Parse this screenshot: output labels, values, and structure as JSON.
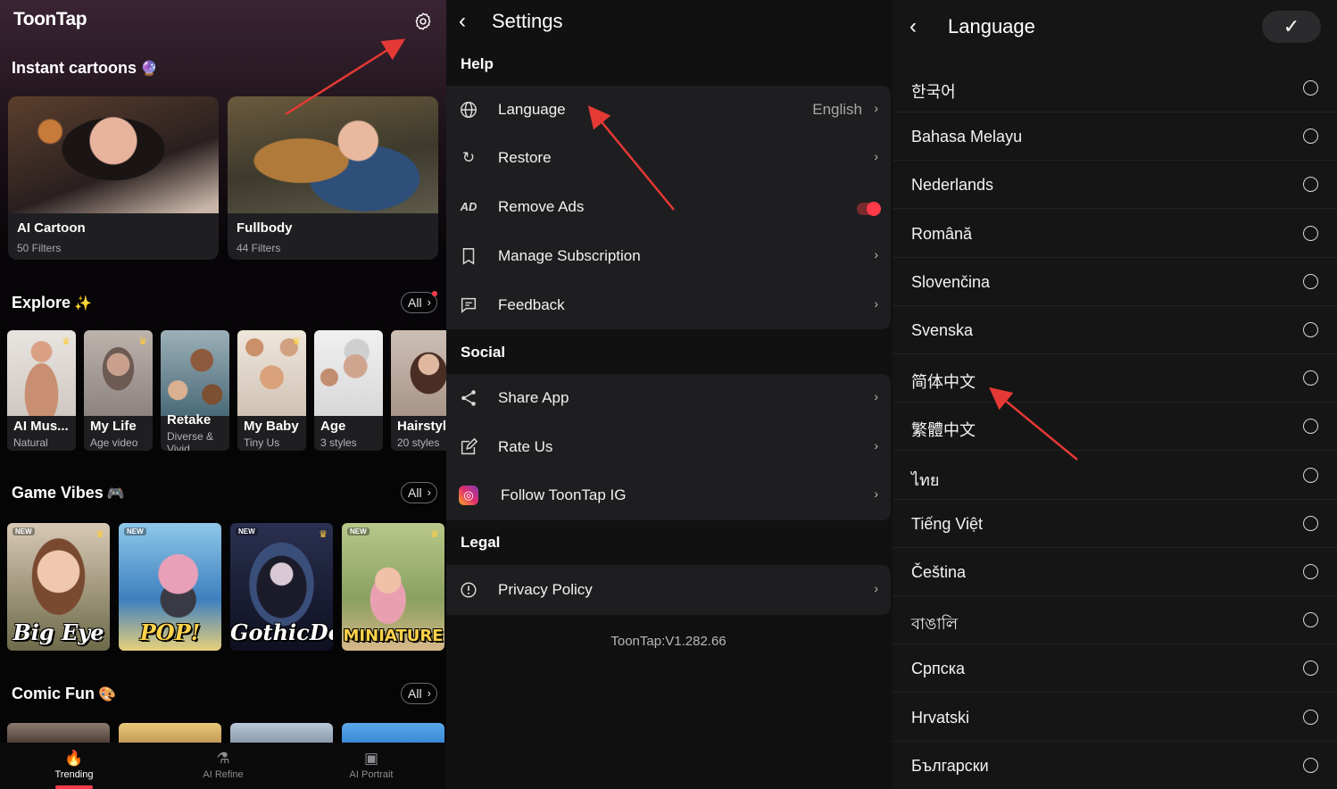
{
  "home": {
    "logo": "ToonTap",
    "instant_title": "Instant cartoons",
    "big_cards": [
      {
        "title": "AI Cartoon",
        "sub": "50 Filters"
      },
      {
        "title": "Fullbody",
        "sub": "44 Filters"
      }
    ],
    "explore_title": "Explore",
    "all_label": "All",
    "explore_cards": [
      {
        "title": "AI Mus...",
        "sub": "Natural"
      },
      {
        "title": "My Life",
        "sub": "Age video"
      },
      {
        "title": "Retake",
        "sub": "Diverse & Vivid"
      },
      {
        "title": "My Baby",
        "sub": "Tiny Us"
      },
      {
        "title": "Age",
        "sub": "3 styles"
      },
      {
        "title": "Hairstyl",
        "sub": "20 styles"
      }
    ],
    "game_title": "Game Vibes",
    "game_cards": [
      {
        "label": "Big Eye"
      },
      {
        "label": "POP!"
      },
      {
        "label": "GothicDoll"
      },
      {
        "label": "MINIATURE"
      }
    ],
    "new_badge": "NEW",
    "comic_title": "Comic Fun",
    "tabs": [
      {
        "label": "Trending",
        "icon": "flame-icon"
      },
      {
        "label": "AI Refine",
        "icon": "flask-icon"
      },
      {
        "label": "AI Portrait",
        "icon": "portrait-icon"
      }
    ]
  },
  "settings": {
    "title": "Settings",
    "help_label": "Help",
    "help_items": [
      {
        "label": "Language",
        "value": "English",
        "icon": "globe-icon"
      },
      {
        "label": "Restore",
        "icon": "refresh-icon"
      },
      {
        "label": "Remove Ads",
        "icon": "no-ads-icon",
        "toggle": true
      },
      {
        "label": "Manage Subscription",
        "icon": "bookmark-icon"
      },
      {
        "label": "Feedback",
        "icon": "chat-icon"
      }
    ],
    "social_label": "Social",
    "social_items": [
      {
        "label": "Share App",
        "icon": "share-icon"
      },
      {
        "label": "Rate Us",
        "icon": "edit-icon"
      },
      {
        "label": "Follow ToonTap IG",
        "icon": "instagram-icon"
      }
    ],
    "legal_label": "Legal",
    "legal_items": [
      {
        "label": "Privacy Policy",
        "icon": "info-icon"
      }
    ],
    "version": "ToonTap:V1.282.66"
  },
  "language": {
    "title": "Language",
    "items": [
      "한국어",
      "Bahasa Melayu",
      "Nederlands",
      "Română",
      "Slovenčina",
      "Svenska",
      "简体中文",
      "繁體中文",
      "ไทย",
      "Tiếng Việt",
      "Čeština",
      "বাঙালি",
      "Српска",
      "Hrvatski",
      "Български"
    ]
  },
  "colors": {
    "accent": "#ff3b4a",
    "arrow": "#e53935"
  }
}
